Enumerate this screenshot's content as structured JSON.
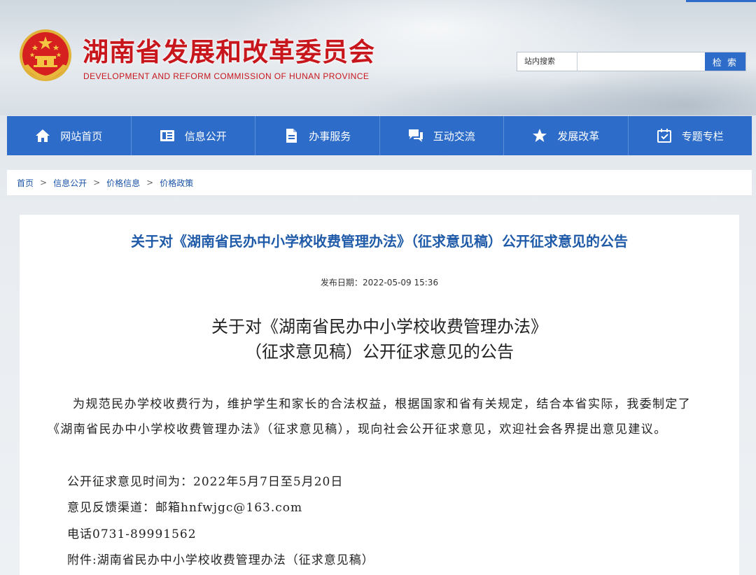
{
  "header": {
    "title": "湖南省发展和改革委员会",
    "subtitle": "DEVELOPMENT AND REFORM COMMISSION OF HUNAN PROVINCE",
    "search": {
      "label": "站内搜索",
      "placeholder": "",
      "button_label": "检 索"
    }
  },
  "nav": {
    "items": [
      {
        "label": "网站首页",
        "icon": "home-icon"
      },
      {
        "label": "信息公开",
        "icon": "info-list-icon"
      },
      {
        "label": "办事服务",
        "icon": "document-icon"
      },
      {
        "label": "互动交流",
        "icon": "chat-icon"
      },
      {
        "label": "发展改革",
        "icon": "star-icon"
      },
      {
        "label": "专题专栏",
        "icon": "calendar-check-icon"
      }
    ]
  },
  "breadcrumb": {
    "items": [
      "首页",
      "信息公开",
      "价格信息",
      "价格政策"
    ],
    "separator": ">"
  },
  "article": {
    "heading": "关于对《湖南省民办中小学校收费管理办法》（征求意见稿）公开征求意见的公告",
    "publish_label": "发布日期：",
    "publish_date": "2022-05-09 15:36",
    "doc_title_line1": "关于对《湖南省民办中小学校收费管理办法》",
    "doc_title_line2": "（征求意见稿）公开征求意见的公告",
    "paragraph": "为规范民办学校收费行为，维护学生和家长的合法权益，根据国家和省有关规定，结合本省实际，我委制定了《湖南省民办中小学校收费管理办法》（征求意见稿），现向社会公开征求意见，欢迎社会各界提出意见建议。",
    "period": "公开征求意见时间为：2022年5月7日至5月20日",
    "feedback": "意见反馈渠道：邮箱hnfwjgc@163.com",
    "phone": "电话0731-89991562",
    "attachment": "附件:湖南省民办中小学校收费管理办法（征求意见稿）"
  },
  "colors": {
    "brand_red": "#c8161d",
    "nav_blue": "#2d6cc8",
    "heading_blue": "#1f5ba8",
    "link_blue": "#1a53a6"
  }
}
